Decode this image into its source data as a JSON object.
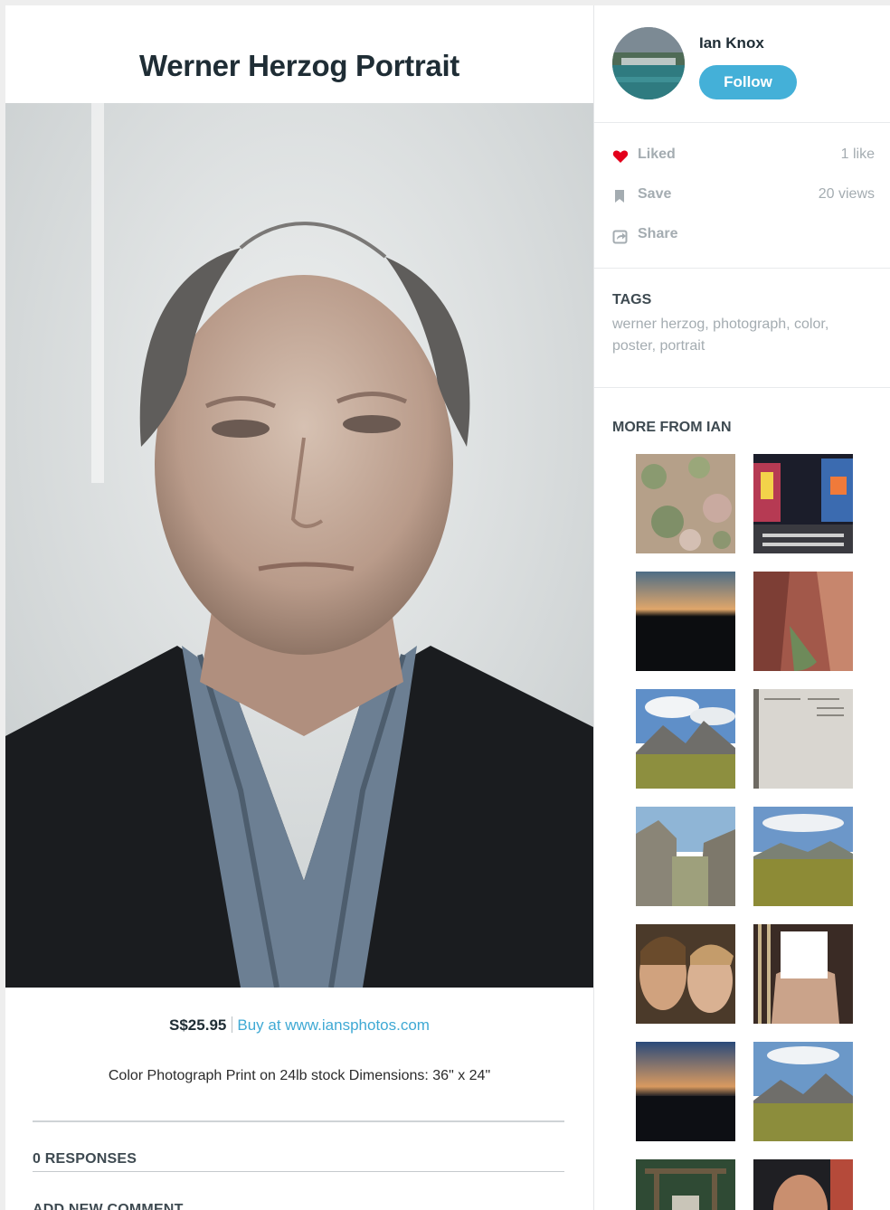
{
  "post": {
    "title": "Werner Herzog Portrait",
    "price": "S$25.95",
    "buy_link": "Buy at www.iansphotos.com",
    "description": "Color Photograph Print on 24lb stock Dimensions: 36\" x 24\"",
    "responses_label": "0 RESPONSES",
    "add_comment_label": "ADD NEW COMMENT"
  },
  "author": {
    "name": "Ian Knox",
    "follow_label": "Follow"
  },
  "actions": {
    "liked_label": "Liked",
    "likes_count": "1 like",
    "save_label": "Save",
    "views_count": "20 views",
    "share_label": "Share"
  },
  "tags": {
    "heading": "TAGS",
    "list": "werner herzog, photograph, color, poster, portrait"
  },
  "more": {
    "heading": "MORE FROM IAN",
    "thumbnails": [
      {
        "name": "thumb-rock-texture",
        "icon": "image-thumbnail"
      },
      {
        "name": "thumb-city-night",
        "icon": "image-thumbnail"
      },
      {
        "name": "thumb-sunset-ridge",
        "icon": "image-thumbnail"
      },
      {
        "name": "thumb-canyon",
        "icon": "image-thumbnail"
      },
      {
        "name": "thumb-mountains-1",
        "icon": "image-thumbnail"
      },
      {
        "name": "thumb-document",
        "icon": "image-thumbnail"
      },
      {
        "name": "thumb-rocky-valley",
        "icon": "image-thumbnail"
      },
      {
        "name": "thumb-meadow",
        "icon": "image-thumbnail"
      },
      {
        "name": "thumb-two-faces",
        "icon": "image-thumbnail"
      },
      {
        "name": "thumb-redacted-person",
        "icon": "image-thumbnail"
      },
      {
        "name": "thumb-sunset-2",
        "icon": "image-thumbnail"
      },
      {
        "name": "thumb-mountains-2",
        "icon": "image-thumbnail"
      },
      {
        "name": "thumb-shrine",
        "icon": "image-thumbnail"
      },
      {
        "name": "thumb-smiling-man",
        "icon": "image-thumbnail"
      }
    ]
  },
  "colors": {
    "accent": "#44b0d8",
    "link": "#3fa9d4",
    "heart": "#e3001b",
    "muted": "#a4acb1",
    "heading": "#1f2d35"
  }
}
